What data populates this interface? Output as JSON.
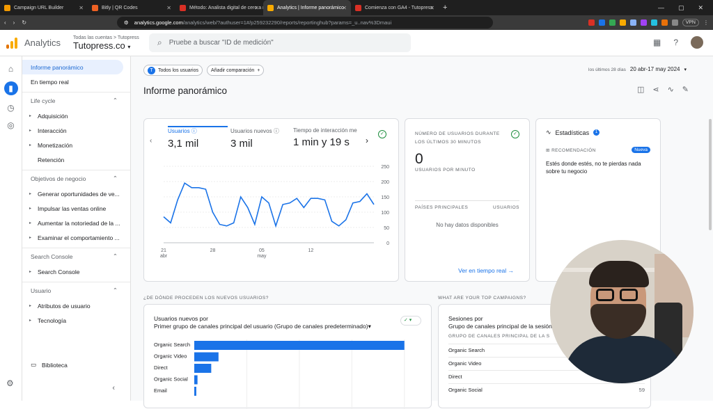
{
  "browser": {
    "tabs": [
      {
        "label": "Campaign URL Builder",
        "fav": "#f29900",
        "active": false
      },
      {
        "label": "Bitly | QR Codes",
        "fav": "#ee6123",
        "active": false
      },
      {
        "label": "Método: Analista digital de cero a m",
        "fav": "#d93025",
        "active": false
      },
      {
        "label": "Analytics | Informe panorámico",
        "fav": "#f9ab00",
        "active": true
      },
      {
        "label": "Comienza con GA4 - Tutopress",
        "fav": "#d93025",
        "active": false
      }
    ],
    "new_tab": "+",
    "url_host": "analytics.google.com",
    "url_path": "/analytics/web/?authuser=1#/p259232290/reports/reportinghub?params=_u..nav%3Dmaui",
    "vpn_label": "VPN"
  },
  "header": {
    "brand": "Analytics",
    "crumb": "Todas las cuentas > Tutopress",
    "property": "Tutopress.co",
    "search_placeholder": "Pruebe a buscar \"ID de medición\""
  },
  "nav": {
    "top": [
      {
        "label": "Informe panorámico",
        "selected": true
      },
      {
        "label": "En tiempo real",
        "selected": false
      }
    ],
    "sections": [
      {
        "title": "Life cycle",
        "items": [
          {
            "label": "Adquisición",
            "tri": true
          },
          {
            "label": "Interacción",
            "tri": true
          },
          {
            "label": "Monetización",
            "tri": true
          },
          {
            "label": "Retención",
            "tri": false
          }
        ]
      },
      {
        "title": "Objetivos de negocio",
        "items": [
          {
            "label": "Generar oportunidades de ve...",
            "tri": true
          },
          {
            "label": "Impulsar las ventas online",
            "tri": true
          },
          {
            "label": "Aumentar la notoriedad de la ...",
            "tri": true
          },
          {
            "label": "Examinar el comportamiento ...",
            "tri": true
          }
        ]
      },
      {
        "title": "Search Console",
        "items": [
          {
            "label": "Search Console",
            "tri": true
          }
        ]
      },
      {
        "title": "Usuario",
        "items": [
          {
            "label": "Atributos de usuario",
            "tri": true
          },
          {
            "label": "Tecnología",
            "tri": true
          }
        ]
      }
    ],
    "library": "Biblioteca"
  },
  "main": {
    "chip_all_users": "Todos los usuarios",
    "chip_badge": "T",
    "add_comparison": "Añadir comparación",
    "date_label": "los últimos 28 días",
    "date_range": "20 abr-17 may 2024",
    "title": "Informe panorámico",
    "metrics": [
      {
        "label": "Usuarios",
        "value": "3,1 mil",
        "active": true
      },
      {
        "label": "Usuarios nuevos",
        "value": "3 mil",
        "active": false
      },
      {
        "label": "Tiempo de interacción me",
        "value": "1 min y 19 s",
        "active": false
      }
    ],
    "realtime": {
      "title": "Número de usuarios durante los últimos 30 minutos",
      "value": "0",
      "subtitle": "Usuarios por minuto",
      "col1": "Países principales",
      "col2": "Usuarios",
      "no_data": "No hay datos disponibles",
      "link": "Ver en tiempo real"
    },
    "insights": {
      "title": "Estadísticas",
      "badge": "1",
      "rec_label": "RECOMENDACIÓN",
      "new_badge": "Nueva",
      "message": "Estés donde estés, no te pierdas nada sobre tu negocio"
    },
    "section_new_users": "¿DE DÓNDE PROCEDEN LOS NUEVOS USUARIOS?",
    "section_campaigns": "WHAT ARE YOUR TOP CAMPAIGNS?",
    "new_users_card": {
      "line1": "Usuarios nuevos por",
      "line2": "Primer grupo de canales principal del usuario (Grupo de canales predeterminado)"
    },
    "campaigns_card": {
      "line1": "Sesiones por",
      "line2": "Grupo de canales principal de la sesión",
      "header": "Grupo de canales principal de la s",
      "rows": [
        {
          "label": "Organic Search",
          "value": ""
        },
        {
          "label": "Organic Video",
          "value": ""
        },
        {
          "label": "Direct",
          "value": ""
        },
        {
          "label": "Organic Social",
          "value": "59"
        }
      ]
    }
  },
  "chart_data": [
    {
      "type": "line",
      "title": "",
      "x_tick_labels": [
        "21 abr",
        "28",
        "05 may",
        "12"
      ],
      "y_ticks": [
        0,
        50,
        100,
        150,
        200,
        250
      ],
      "ylim": [
        0,
        250
      ],
      "series": [
        {
          "values": [
            85,
            65,
            140,
            195,
            180,
            180,
            175,
            100,
            60,
            55,
            65,
            150,
            115,
            60,
            150,
            130,
            55,
            125,
            130,
            145,
            115,
            145,
            145,
            140,
            70,
            55,
            75,
            130,
            135,
            160,
            125
          ]
        }
      ]
    },
    {
      "type": "bar",
      "orientation": "horizontal",
      "categories": [
        "Organic Search",
        "Organic Video",
        "Direct",
        "Organic Social",
        "Email"
      ],
      "values": [
        2600,
        300,
        210,
        40,
        25
      ]
    }
  ]
}
